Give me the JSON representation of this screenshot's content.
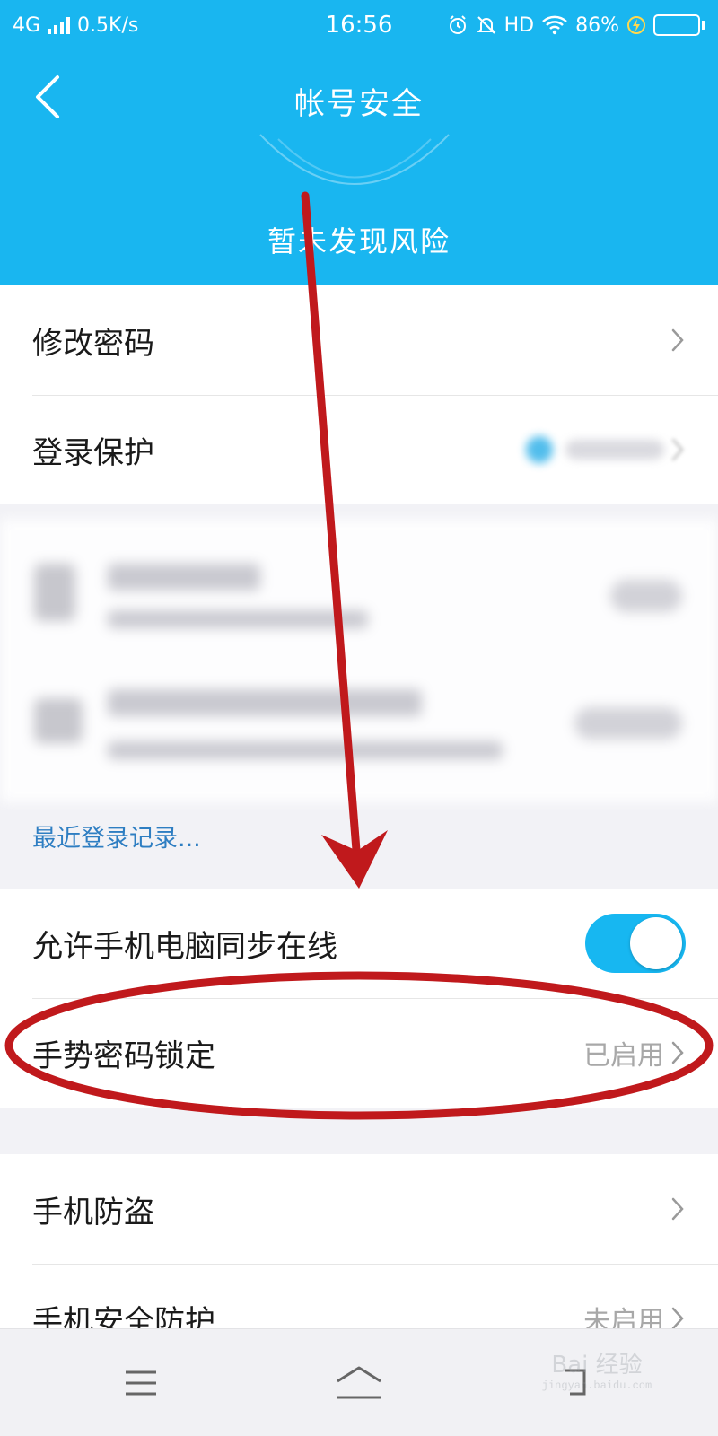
{
  "status_bar": {
    "network": "4G",
    "speed": "0.5K/s",
    "time": "16:56",
    "hd": "HD",
    "battery": "86%",
    "battery_level": 0.86
  },
  "header": {
    "title": "帐号安全",
    "risk_status": "暂未发现风险",
    "background_color": "#19b6f0"
  },
  "account_section": {
    "change_password": "修改密码",
    "login_protection": "登录保护"
  },
  "recent_login_link": "最近登录记录...",
  "sync_section": {
    "allow_sync_online": "允许手机电脑同步在线",
    "allow_sync_enabled": true,
    "gesture_lock": "手势密码锁定",
    "gesture_lock_status": "已启用"
  },
  "phone_section": {
    "anti_theft": "手机防盗",
    "security_protection": "手机安全防护",
    "security_protection_status": "未启用"
  },
  "bottom_nav": {
    "icons": [
      "menu-icon",
      "home-icon",
      "back-icon"
    ]
  },
  "watermark": {
    "main": "Bai 经验",
    "sub": "jingyan.baidu.com"
  },
  "colors": {
    "accent": "#17b7f1",
    "annotation": "#c0191c",
    "link": "#2e7ec2"
  }
}
